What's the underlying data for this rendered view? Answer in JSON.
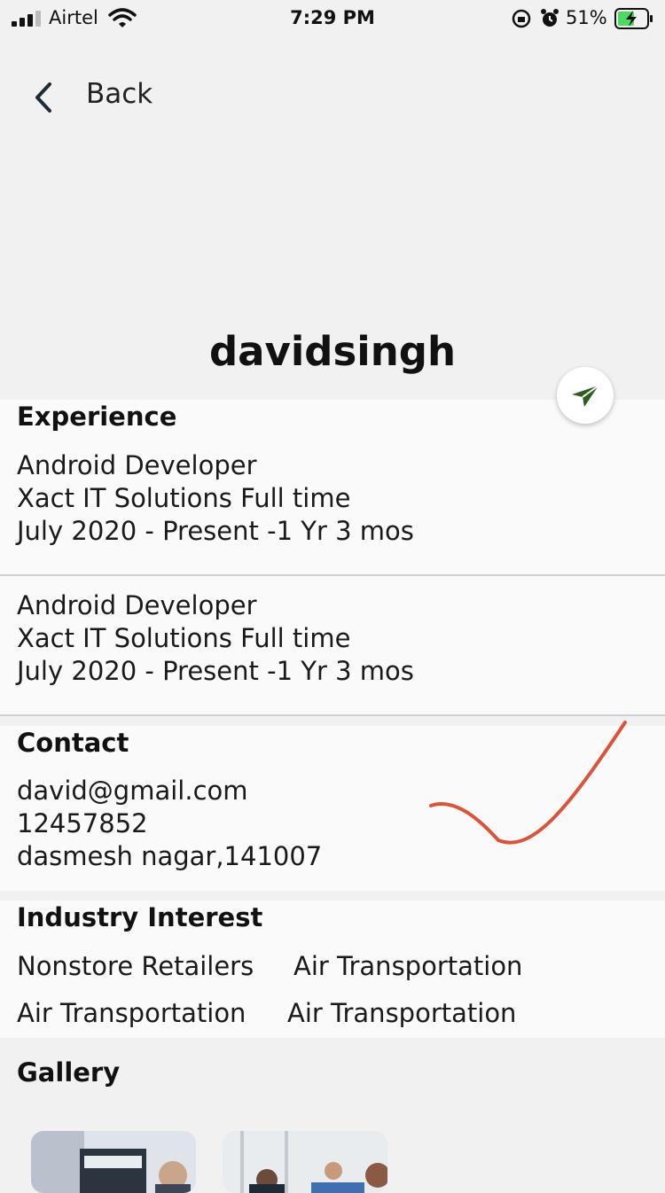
{
  "status_bar": {
    "carrier": "Airtel",
    "time": "7:29 PM",
    "battery_percent": "51%"
  },
  "nav": {
    "back_label": "Back"
  },
  "profile": {
    "username": "davidsingh"
  },
  "experience": {
    "title": "Experience",
    "items": [
      {
        "role": "Android Developer",
        "company": "Xact IT Solutions Full time",
        "period": "July 2020 - Present -1 Yr 3 mos"
      },
      {
        "role": "Android Developer",
        "company": "Xact IT Solutions Full time",
        "period": "July 2020 - Present -1 Yr 3 mos"
      }
    ]
  },
  "contact": {
    "title": "Contact",
    "email": "david@gmail.com",
    "phone": "12457852",
    "address": "dasmesh nagar,141007"
  },
  "industry_interest": {
    "title": "Industry Interest",
    "tags": [
      "Nonstore Retailers",
      "Air Transportation",
      "Air Transportation",
      "Air Transportation"
    ]
  },
  "gallery": {
    "title": "Gallery"
  },
  "colors": {
    "send_icon": "#2e5e1f",
    "checkmark": "#d9543a"
  }
}
